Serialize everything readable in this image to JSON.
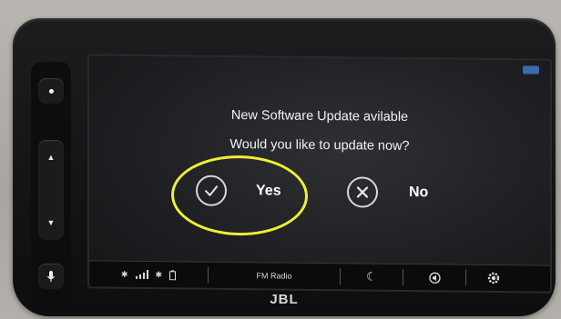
{
  "dialog": {
    "line1": "New Software Update avilable",
    "line2": "Would you like to  update now?",
    "yes_label": "Yes",
    "no_label": "No",
    "highlight_color": "#f1ee34"
  },
  "statusbar": {
    "source_label": "FM Radio",
    "icons": [
      "bluetooth-icon",
      "signal-icon",
      "usb-icon",
      "battery-icon",
      "night-mode-icon",
      "mute-icon",
      "settings-icon"
    ]
  },
  "hardware": {
    "brand": "JBL",
    "buttons": [
      "power-button",
      "volume-up-button",
      "volume-down-button",
      "voice-button"
    ]
  }
}
